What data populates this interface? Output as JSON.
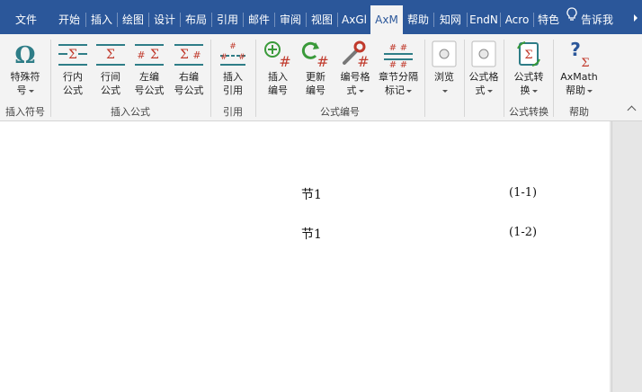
{
  "tabs": [
    {
      "label": "文件"
    },
    {
      "label": "开始"
    },
    {
      "label": "插入"
    },
    {
      "label": "绘图"
    },
    {
      "label": "设计"
    },
    {
      "label": "布局"
    },
    {
      "label": "引用"
    },
    {
      "label": "邮件"
    },
    {
      "label": "审阅"
    },
    {
      "label": "视图"
    },
    {
      "label": "AxGl"
    },
    {
      "label": "AxM"
    },
    {
      "label": "帮助"
    },
    {
      "label": "知网"
    },
    {
      "label": "EndN"
    },
    {
      "label": "Acro"
    },
    {
      "label": "特色"
    }
  ],
  "tell_me": "告诉我",
  "groups": {
    "insert_symbol": {
      "label": "插入符号",
      "special_char": "特殊符",
      "special_char_line2": "号"
    },
    "insert_formula": {
      "label": "插入公式",
      "inline": "行内",
      "inline2": "公式",
      "display": "行间",
      "display2": "公式",
      "left_num": "左编",
      "left_num2": "号公式",
      "right_num": "右编",
      "right_num2": "号公式"
    },
    "reference": {
      "label": "引用",
      "insert_ref": "插入",
      "insert_ref2": "引用"
    },
    "formula_numbering": {
      "label": "公式编号",
      "insert_num": "插入",
      "insert_num2": "编号",
      "update_num": "更新",
      "update_num2": "编号",
      "num_format": "编号格",
      "num_format2": "式",
      "chapter": "章节分隔",
      "chapter2": "标记"
    },
    "browse": {
      "label": "浏览"
    },
    "formula_format": {
      "label": "公式格",
      "label2": "式"
    },
    "formula_convert": {
      "label": "公式转换",
      "btn": "公式转",
      "btn2": "换"
    },
    "help": {
      "label": "帮助",
      "btn": "AxMath",
      "btn2": "帮助"
    }
  },
  "document": {
    "lines": [
      {
        "text": "节1",
        "number": "(1-1)"
      },
      {
        "text": "节1",
        "number": "(1-2)"
      }
    ]
  },
  "colors": {
    "accent": "#2b579a",
    "ribbon_bg": "#f3f3f3",
    "icon_teal": "#2e7d87",
    "icon_red": "#c0392b",
    "icon_green": "#3a9a3a"
  }
}
